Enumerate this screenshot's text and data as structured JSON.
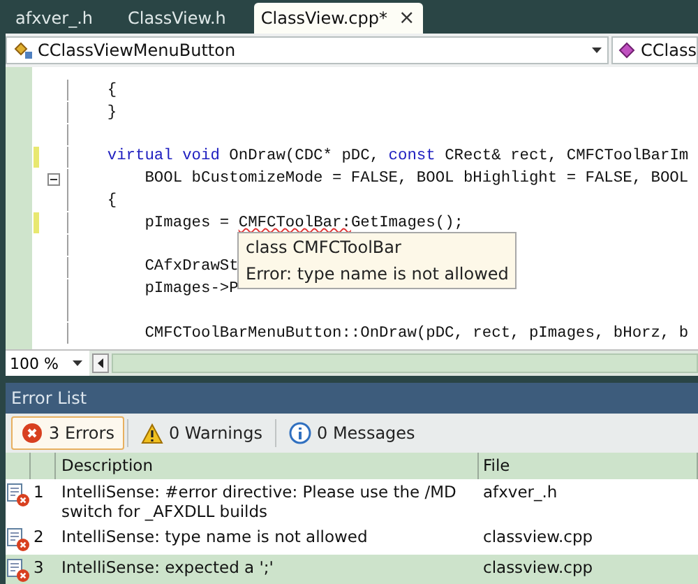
{
  "tabs": [
    {
      "label": "afxver_.h",
      "selected": false
    },
    {
      "label": "ClassView.h",
      "selected": false
    },
    {
      "label": "ClassView.cpp*",
      "selected": true
    }
  ],
  "tab_close": "×",
  "navigation_bar": {
    "class_combo": "CClassViewMenuButton",
    "member_combo": "CClass"
  },
  "code_lines": [
    {
      "changed": false,
      "collapsible": false,
      "segments": [
        {
          "kind": "plain",
          "text": "    {"
        }
      ]
    },
    {
      "changed": false,
      "collapsible": false,
      "segments": [
        {
          "kind": "plain",
          "text": "    }"
        }
      ]
    },
    {
      "changed": false,
      "collapsible": false
    },
    {
      "changed": true,
      "collapsible": false,
      "segments": [
        {
          "kind": "keyword",
          "text": "    virtual void"
        },
        {
          "kind": "plain",
          "text": " OnDraw(CDC* pDC, "
        },
        {
          "kind": "keyword",
          "text": "const"
        },
        {
          "kind": "plain",
          "text": " CRect& rect, CMFCToolBarIm"
        }
      ]
    },
    {
      "changed": false,
      "collapsible": true,
      "segments": [
        {
          "kind": "plain",
          "text": "        BOOL bCustomizeMode = FALSE, BOOL bHighlight = FALSE, BOOL"
        }
      ]
    },
    {
      "changed": false,
      "collapsible": false,
      "segments": [
        {
          "kind": "plain",
          "text": "    {"
        }
      ]
    },
    {
      "changed": true,
      "collapsible": false,
      "segments": [
        {
          "kind": "plain",
          "text": "        pImages = "
        },
        {
          "kind": "error",
          "text": "CMFCToolBar:"
        },
        {
          "kind": "plain",
          "text": "GetImages();"
        }
      ]
    },
    {
      "changed": false,
      "collapsible": false
    },
    {
      "changed": false,
      "collapsible": false,
      "segments": [
        {
          "kind": "plain",
          "text": "        CAfxDrawSt"
        }
      ]
    },
    {
      "changed": false,
      "collapsible": false,
      "segments": [
        {
          "kind": "plain",
          "text": "        pImages->P"
        }
      ]
    },
    {
      "changed": false,
      "collapsible": false
    },
    {
      "changed": false,
      "collapsible": false,
      "segments": [
        {
          "kind": "plain",
          "text": "        CMFCToolBarMenuButton::OnDraw(pDC, rect, pImages, bHorz, b"
        }
      ]
    }
  ],
  "tooltip": {
    "title": "class CMFCToolBar",
    "message": "Error: type name is not allowed"
  },
  "zoom": "100 %",
  "error_list": {
    "title": "Error List",
    "filters": [
      {
        "kind": "error",
        "label": "3 Errors",
        "selected": true
      },
      {
        "kind": "warning",
        "label": "0 Warnings",
        "selected": false
      },
      {
        "kind": "info",
        "label": "0 Messages",
        "selected": false
      }
    ],
    "columns": [
      "Description",
      "File"
    ],
    "rows": [
      {
        "number": "1",
        "description": "IntelliSense: #error directive: Please use the /MD switch for _AFXDLL builds",
        "file": "afxver_.h",
        "selected": false
      },
      {
        "number": "2",
        "description": "IntelliSense: type name is not allowed",
        "file": "classview.cpp",
        "selected": false
      },
      {
        "number": "3",
        "description": "IntelliSense: expected a ';'",
        "file": "classview.cpp",
        "selected": true
      }
    ]
  }
}
